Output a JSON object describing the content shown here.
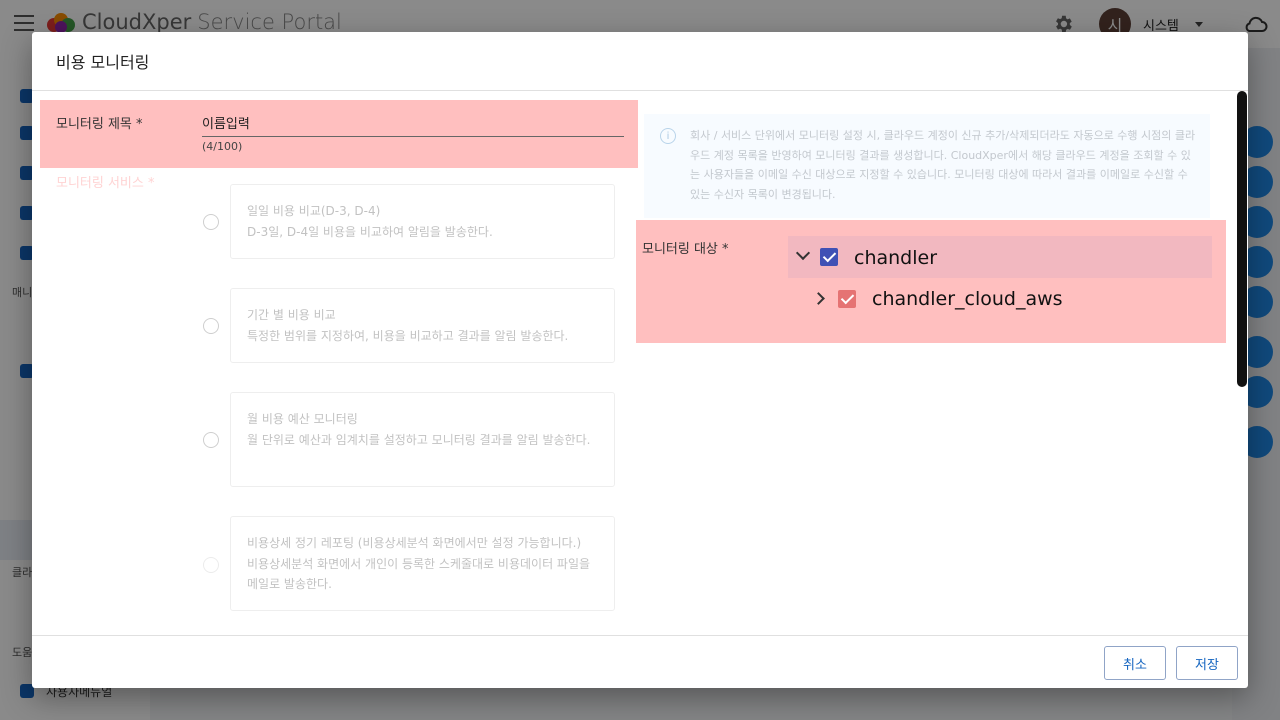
{
  "app": {
    "brand": "CloudXper",
    "brand_sub": "Service Portal",
    "avatar_initial": "시",
    "username": "시스템"
  },
  "nav": {
    "section_manage": "매니",
    "section_cloud": "클라",
    "section_help": "도움",
    "user_manual": "사용자메뉴얼"
  },
  "dialog": {
    "title": "비용 모니터링",
    "title_field": {
      "label": "모니터링 제목 *",
      "value": "이름입력",
      "counter": "(4/100)"
    },
    "service_field": {
      "label": "모니터링 서비스 *",
      "options": [
        {
          "title": "일일 비용 비교(D-3, D-4)",
          "desc": "D-3일, D-4일 비용을 비교하여 알림을 발송한다."
        },
        {
          "title": "기간 별 비용 비교",
          "desc": "특정한 범위를 지정하여, 비용을 비교하고 결과를 알림 발송한다."
        },
        {
          "title": "월 비용 예산 모니터링",
          "desc": "월 단위로 예산과 임계치를 설정하고 모니터링 결과를 알림 발송한다."
        },
        {
          "title": "비용상세 정기 레포팅 (비용상세분석 화면에서만 설정 가능합니다.)",
          "desc": "비용상세분석 화면에서 개인이 등록한 스케줄대로 비용데이터 파일을 메일로 발송한다."
        }
      ]
    },
    "info": {
      "icon": "i",
      "text": "회사 / 서비스 단위에서 모니터링 설정 시, 클라우드 계정이 신규 추가/삭제되더라도 자동으로 수행 시점의 클라우드 계정 목록을 반영하여 모니터링 결과를 생성합니다. CloudXper에서 해당 클라우드 계정을 조회할 수 있는 사용자들을 이메일 수신 대상으로 지정할 수 있습니다. 모니터링 대상에 따라서 결과를 이메일로 수신할 수 있는 수신자 목록이 변경됩니다."
    },
    "target_field": {
      "label": "모니터링 대상 *",
      "tree": {
        "root": "chandler",
        "child": "chandler_cloud_aws"
      }
    },
    "buttons": {
      "cancel": "취소",
      "save": "저장"
    }
  },
  "colors": {
    "highlight": "#ffbfbf",
    "accent": "#3f51b5",
    "button_text": "#1565c0"
  }
}
